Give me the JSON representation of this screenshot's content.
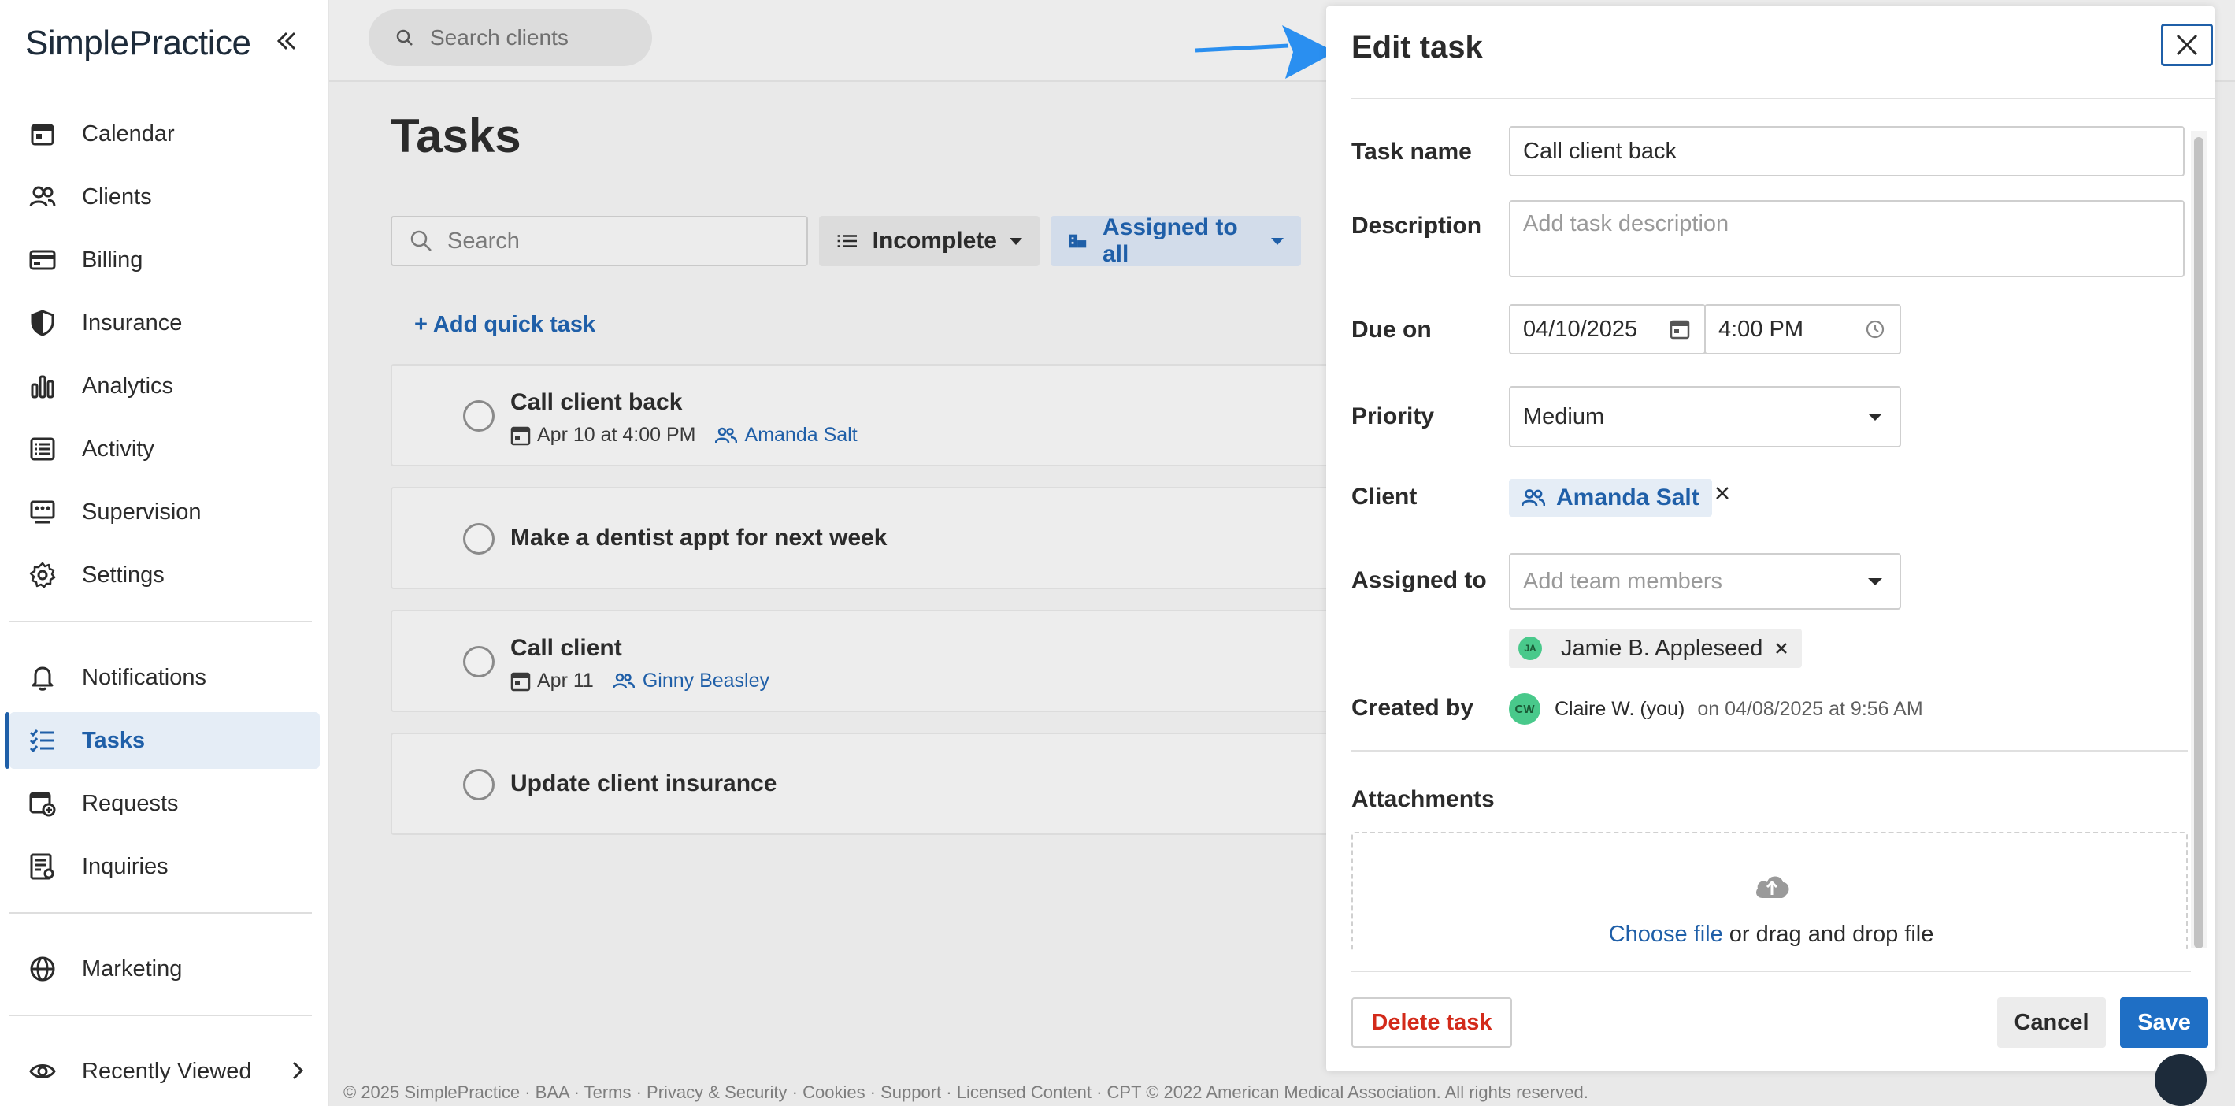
{
  "sidebar": {
    "brand": "SimplePractice",
    "items": [
      {
        "label": "Calendar"
      },
      {
        "label": "Clients"
      },
      {
        "label": "Billing"
      },
      {
        "label": "Insurance"
      },
      {
        "label": "Analytics"
      },
      {
        "label": "Activity"
      },
      {
        "label": "Supervision"
      },
      {
        "label": "Settings"
      },
      {
        "label": "Notifications"
      },
      {
        "label": "Tasks"
      },
      {
        "label": "Requests"
      },
      {
        "label": "Inquiries"
      },
      {
        "label": "Marketing"
      },
      {
        "label": "Recently Viewed"
      }
    ],
    "active": "Tasks"
  },
  "topbar": {
    "search_placeholder": "Search clients"
  },
  "page": {
    "title": "Tasks",
    "search_placeholder": "Search",
    "filter_status": "Incomplete",
    "filter_assigned": "Assigned to all",
    "add_quick_task": "+ Add quick task"
  },
  "tasks": [
    {
      "name": "Call client back",
      "due": "Apr 10 at 4:00 PM",
      "client": "Amanda Salt"
    },
    {
      "name": "Make a dentist appt for next week",
      "due": "",
      "client": ""
    },
    {
      "name": "Call client",
      "due": "Apr 11",
      "client": "Ginny Beasley"
    },
    {
      "name": "Update client insurance",
      "due": "",
      "client": ""
    }
  ],
  "footer": "© 2025 SimplePractice · BAA · Terms · Privacy & Security · Cookies · Support · Licensed Content · CPT © 2022 American Medical Association. All rights reserved.",
  "edit_task": {
    "title": "Edit task",
    "task_name_label": "Task name",
    "task_name_value": "Call client back",
    "description_label": "Description",
    "description_placeholder": "Add task description",
    "due_on_label": "Due on",
    "due_date": "04/10/2025",
    "due_time": "4:00 PM",
    "priority_label": "Priority",
    "priority_value": "Medium",
    "client_label": "Client",
    "client_value": "Amanda Salt",
    "assigned_label": "Assigned to",
    "assigned_placeholder": "Add team members",
    "assigned_member": {
      "initials": "JA",
      "name": "Jamie B. Appleseed"
    },
    "created_label": "Created by",
    "creator": {
      "initials": "CW",
      "name": "Claire W. (you)"
    },
    "created_on": "on 04/08/2025 at 9:56 AM",
    "attachments_label": "Attachments",
    "choose_file": "Choose file",
    "drop_text": " or drag and drop file",
    "delete_label": "Delete task",
    "cancel_label": "Cancel",
    "save_label": "Save"
  },
  "colors": {
    "accent": "#1f5fa8",
    "save": "#1f6fc5",
    "delete": "#d32a1a",
    "arrow": "#2a8ff0",
    "avatar": "#49c98b"
  }
}
